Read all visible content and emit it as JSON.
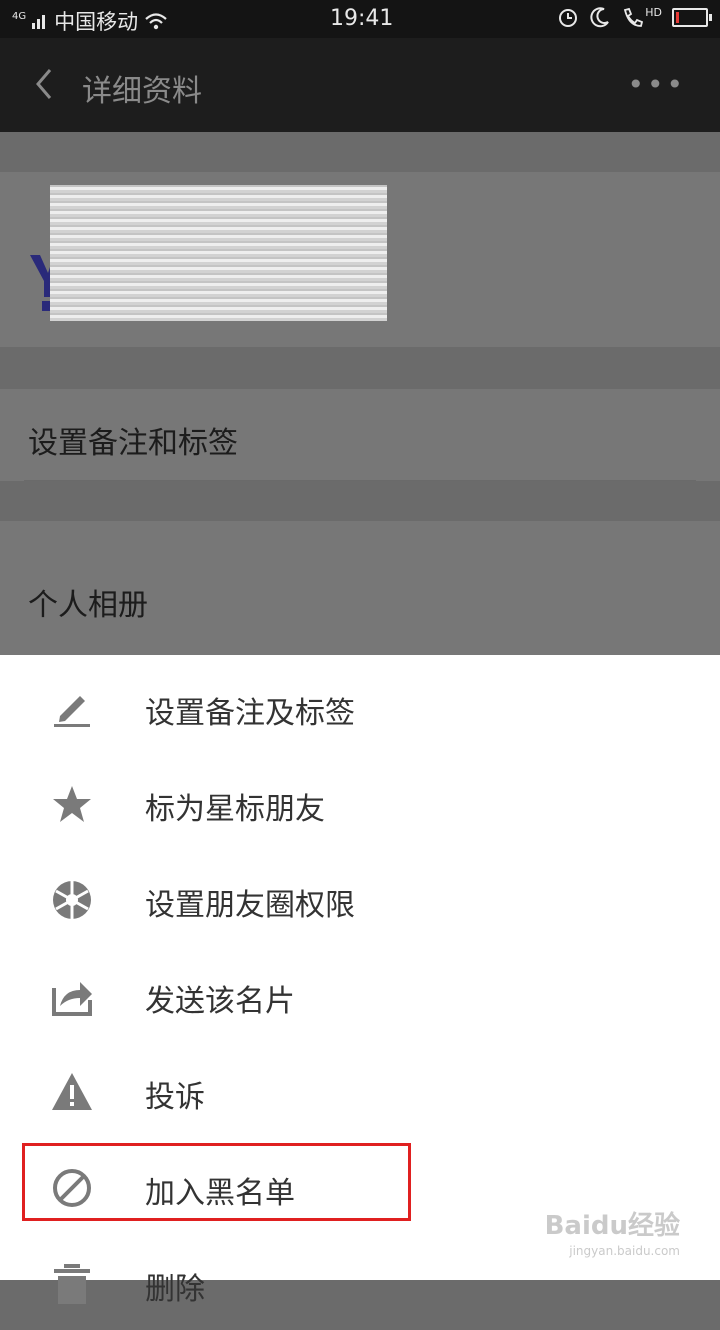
{
  "status_bar": {
    "network_type": "4G",
    "carrier": "中国移动",
    "time": "19:41",
    "hd_label": "HD",
    "battery_level": 0.12,
    "battery_color": "#e53935"
  },
  "app_bar": {
    "title": "详细资料",
    "back_icon": "chevron-left-icon",
    "more_icon": "more-dots-icon"
  },
  "profile": {
    "avatar_icon": "blurred-logo-image"
  },
  "rows": {
    "remark_label": "设置备注和标签",
    "album_label": "个人相册"
  },
  "action_sheet": {
    "items": [
      {
        "label": "设置备注及标签",
        "icon": "edit-pencil-icon"
      },
      {
        "label": "标为星标朋友",
        "icon": "star-icon"
      },
      {
        "label": "设置朋友圈权限",
        "icon": "aperture-icon"
      },
      {
        "label": "发送该名片",
        "icon": "share-icon"
      },
      {
        "label": "投诉",
        "icon": "warning-icon"
      },
      {
        "label": "加入黑名单",
        "icon": "block-icon"
      },
      {
        "label": "删除",
        "icon": "trash-icon"
      }
    ],
    "highlighted_index": 5,
    "highlight_color": "#e02020"
  },
  "watermark": {
    "text": "Baidu经验",
    "sub": "jingyan.baidu.com"
  }
}
